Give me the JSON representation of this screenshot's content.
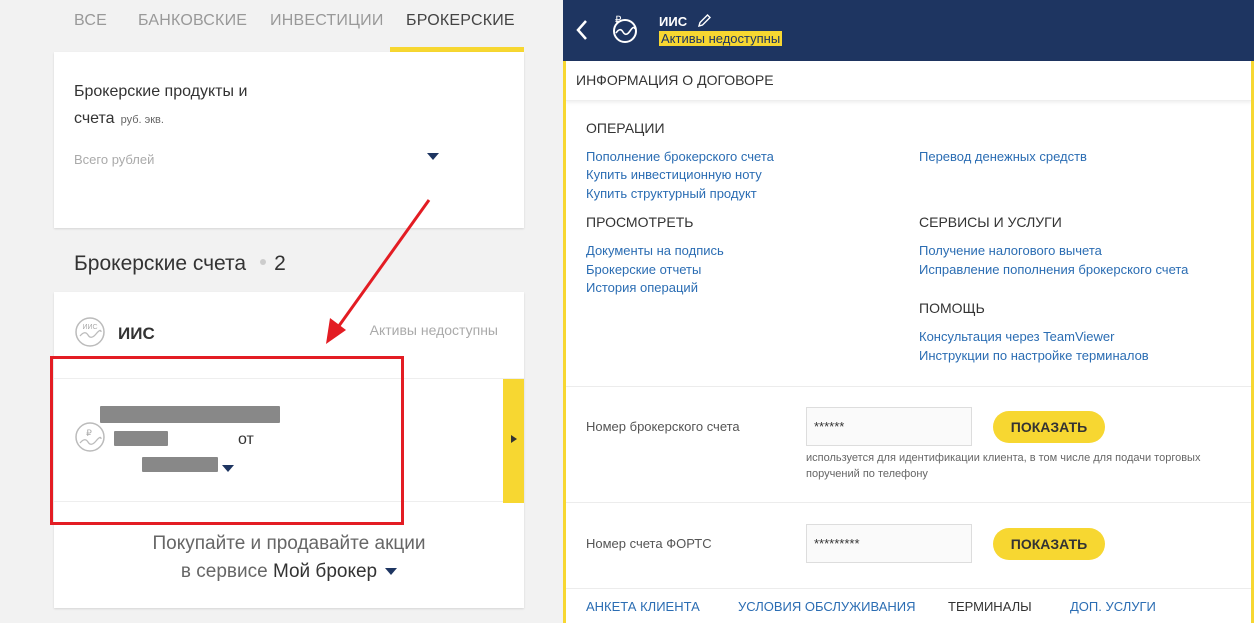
{
  "left": {
    "tabs": [
      {
        "label": "ВСЕ"
      },
      {
        "label": "БАНКОВСКИЕ"
      },
      {
        "label": "ИНВЕСТИЦИИ"
      },
      {
        "label": "БРОКЕРСКИЕ",
        "active": true
      }
    ],
    "summary": {
      "title": "Брокерские продукты и счета",
      "currency_note": "руб. экв.",
      "total_label": "Всего рублей"
    },
    "section": {
      "title": "Брокерские счета",
      "count": "2"
    },
    "accounts": [
      {
        "name": "ИИС",
        "status": "Активы недоступны",
        "icon": "iis-ruble-icon"
      },
      {
        "connector": "от",
        "icon": "ruble-account-icon"
      }
    ],
    "promo": {
      "line1": "Покупайте и продавайте акции",
      "line2_prefix": "в сервисе",
      "line2_service": "Мой брокер"
    }
  },
  "right": {
    "header": {
      "title": "ИИС",
      "status": "Активы недоступны"
    },
    "info_title": "ИНФОРМАЦИЯ О ДОГОВОРЕ",
    "operations": {
      "title": "ОПЕРАЦИИ",
      "links": [
        "Пополнение брокерского счета",
        "Купить инвестиционную ноту",
        "Купить структурный продукт"
      ],
      "right_link": "Перевод денежных средств"
    },
    "view": {
      "title": "ПРОСМОТРЕТЬ",
      "links": [
        "Документы на подпись",
        "Брокерские отчеты",
        "История операций"
      ]
    },
    "services": {
      "title": "СЕРВИСЫ И УСЛУГИ",
      "links": [
        "Получение налогового вычета",
        "Исправление пополнения брокерского счета"
      ]
    },
    "help": {
      "title": "ПОМОЩЬ",
      "links": [
        "Консультация через TeamViewer",
        "Инструкции по настройке терминалов"
      ]
    },
    "broker_account": {
      "label": "Номер брокерского счета",
      "value": "******",
      "button": "ПОКАЗАТЬ",
      "hint": "используется для идентификации клиента, в том числе для подачи торговых поручений по телефону"
    },
    "forts_account": {
      "label": "Номер счета ФОРТС",
      "value": "*********",
      "button": "ПОКАЗАТЬ"
    },
    "bottom_tabs": [
      "АНКЕТА КЛИЕНТА",
      "УСЛОВИЯ ОБСЛУЖИВАНИЯ",
      "ТЕРМИНАЛЫ",
      "ДОП. УСЛУГИ"
    ]
  },
  "colors": {
    "brand_navy": "#1e3561",
    "accent_yellow": "#f7d731",
    "link_blue": "#2b6db3",
    "annotation_red": "#e31c23"
  }
}
